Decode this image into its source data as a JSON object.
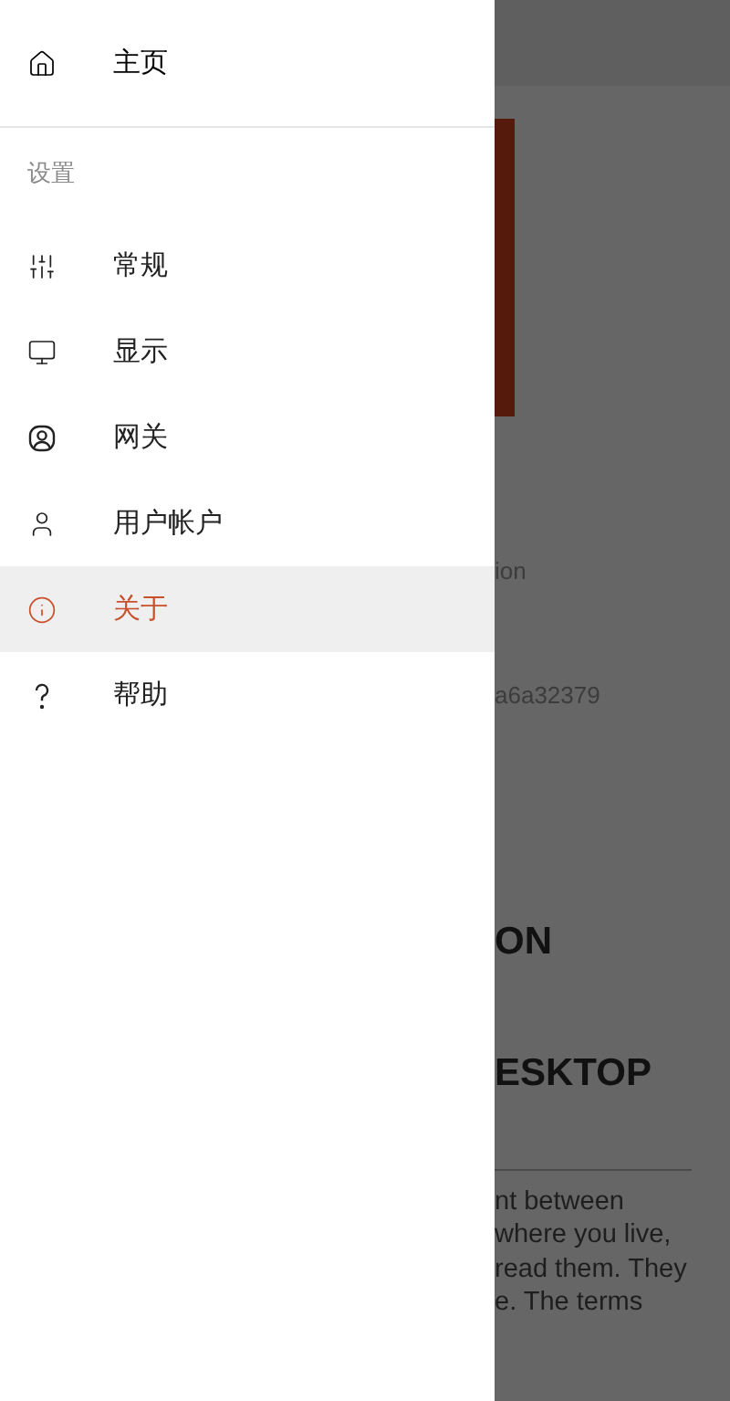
{
  "drawer": {
    "home": {
      "label": "主页",
      "kind": "home"
    },
    "section_label": "设置",
    "items": [
      {
        "label": "常规",
        "kind": "sliders",
        "selected": false
      },
      {
        "label": "显示",
        "kind": "monitor",
        "selected": false
      },
      {
        "label": "网关",
        "kind": "gateway",
        "selected": false
      },
      {
        "label": "用户帐户",
        "kind": "user",
        "selected": false
      },
      {
        "label": "关于",
        "kind": "info",
        "selected": true
      },
      {
        "label": "帮助",
        "kind": "help",
        "selected": false
      }
    ]
  },
  "background": {
    "caption": "ion",
    "hash": "a6a32379",
    "heading_1": "ON",
    "heading_2": "ESKTOP",
    "paragraph_lines": [
      "nt between",
      "where you live,",
      "read them. They",
      "e. The terms"
    ]
  }
}
